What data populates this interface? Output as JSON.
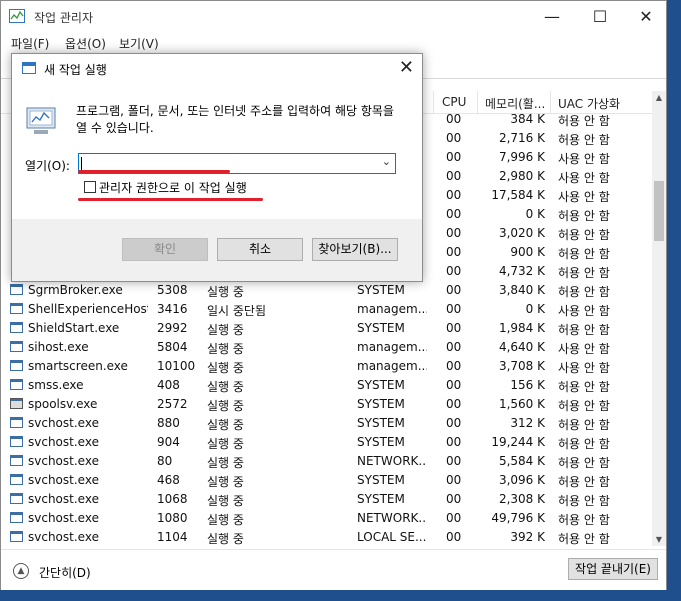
{
  "window": {
    "title": "작업 관리자"
  },
  "menu": [
    "파일(F)",
    "옵션(O)",
    "보기(V)"
  ],
  "columns": {
    "cpu": "CPU",
    "memory": "메모리(활...",
    "uac": "UAC 가상화"
  },
  "background_rows": [
    {
      "cpu": "00",
      "mem": "384 K",
      "uac": "허용 안 함"
    },
    {
      "cpu": "00",
      "mem": "2,716 K",
      "uac": "허용 안 함"
    },
    {
      "cpu": "00",
      "mem": "7,996 K",
      "uac": "사용 안 함"
    },
    {
      "cpu": "00",
      "mem": "2,980 K",
      "uac": "사용 안 함"
    },
    {
      "cpu": "00",
      "mem": "17,584 K",
      "uac": "사용 안 함"
    },
    {
      "cpu": "00",
      "mem": "0 K",
      "uac": "허용 안 함"
    },
    {
      "cpu": "00",
      "mem": "3,020 K",
      "uac": "허용 안 함"
    },
    {
      "cpu": "00",
      "mem": "900 K",
      "uac": "허용 안 함"
    },
    {
      "cpu": "00",
      "mem": "4,732 K",
      "uac": "허용 안 함"
    }
  ],
  "processes": [
    {
      "name": "SgrmBroker.exe",
      "pid": "5308",
      "status": "실행 중",
      "user": "SYSTEM",
      "cpu": "00",
      "mem": "3,840 K",
      "uac": "허용 안 함"
    },
    {
      "name": "ShellExperienceHost...",
      "pid": "3416",
      "status": "일시 중단됨",
      "user": "managem...",
      "cpu": "00",
      "mem": "0 K",
      "uac": "사용 안 함"
    },
    {
      "name": "ShieldStart.exe",
      "pid": "2992",
      "status": "실행 중",
      "user": "SYSTEM",
      "cpu": "00",
      "mem": "1,984 K",
      "uac": "허용 안 함"
    },
    {
      "name": "sihost.exe",
      "pid": "5804",
      "status": "실행 중",
      "user": "managem...",
      "cpu": "00",
      "mem": "4,640 K",
      "uac": "사용 안 함"
    },
    {
      "name": "smartscreen.exe",
      "pid": "10100",
      "status": "실행 중",
      "user": "managem...",
      "cpu": "00",
      "mem": "3,708 K",
      "uac": "사용 안 함"
    },
    {
      "name": "smss.exe",
      "pid": "408",
      "status": "실행 중",
      "user": "SYSTEM",
      "cpu": "00",
      "mem": "156 K",
      "uac": "허용 안 함"
    },
    {
      "name": "spoolsv.exe",
      "pid": "2572",
      "status": "실행 중",
      "user": "SYSTEM",
      "cpu": "00",
      "mem": "1,560 K",
      "uac": "허용 안 함"
    },
    {
      "name": "svchost.exe",
      "pid": "880",
      "status": "실행 중",
      "user": "SYSTEM",
      "cpu": "00",
      "mem": "312 K",
      "uac": "허용 안 함"
    },
    {
      "name": "svchost.exe",
      "pid": "904",
      "status": "실행 중",
      "user": "SYSTEM",
      "cpu": "00",
      "mem": "19,244 K",
      "uac": "허용 안 함"
    },
    {
      "name": "svchost.exe",
      "pid": "80",
      "status": "실행 중",
      "user": "NETWORK...",
      "cpu": "00",
      "mem": "5,584 K",
      "uac": "허용 안 함"
    },
    {
      "name": "svchost.exe",
      "pid": "468",
      "status": "실행 중",
      "user": "SYSTEM",
      "cpu": "00",
      "mem": "3,096 K",
      "uac": "허용 안 함"
    },
    {
      "name": "svchost.exe",
      "pid": "1068",
      "status": "실행 중",
      "user": "SYSTEM",
      "cpu": "00",
      "mem": "2,308 K",
      "uac": "허용 안 함"
    },
    {
      "name": "svchost.exe",
      "pid": "1080",
      "status": "실행 중",
      "user": "NETWORK...",
      "cpu": "00",
      "mem": "49,796 K",
      "uac": "허용 안 함"
    },
    {
      "name": "svchost.exe",
      "pid": "1104",
      "status": "실행 중",
      "user": "LOCAL SE...",
      "cpu": "00",
      "mem": "392 K",
      "uac": "허용 안 함"
    }
  ],
  "footer": {
    "collapse_label": "간단히(D)",
    "end_task": "작업 끝내기(E)"
  },
  "dialog": {
    "title": "새 작업 실행",
    "description": "프로그램, 폴더, 문서, 또는 인터넷 주소를 입력하여 해당 항목을 열 수 있습니다.",
    "open_label": "열기(O):",
    "open_value": "",
    "admin_checkbox_label": "관리자 권한으로 이 작업 실행",
    "admin_checked": false,
    "ok": "확인",
    "cancel": "취소",
    "browse": "찾아보기(B)..."
  },
  "colors": {
    "accent": "#0078d7",
    "annotation_red": "#e0202a"
  }
}
